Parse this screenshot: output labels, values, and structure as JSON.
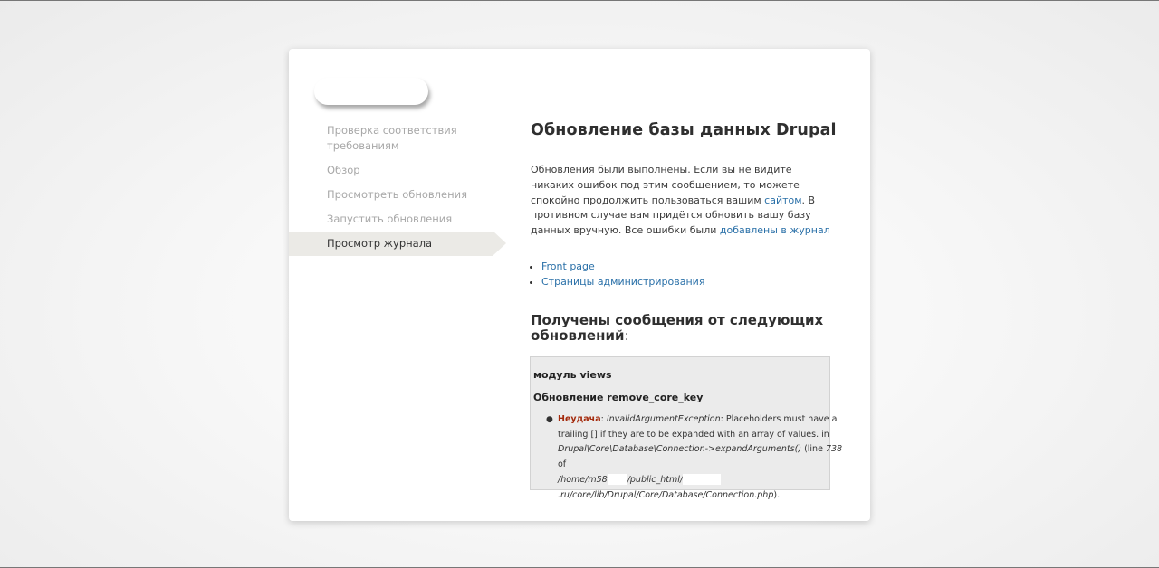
{
  "sidebar": {
    "items": [
      {
        "label": "Проверка соответствия требованиям"
      },
      {
        "label": "Обзор"
      },
      {
        "label": "Просмотреть обновления"
      },
      {
        "label": "Запустить обновления"
      },
      {
        "label": "Просмотр журнала"
      }
    ],
    "active_index": 4
  },
  "main": {
    "title": "Обновление базы данных Drupal",
    "intro_part1": "Обновления были выполнены. Если вы не видите никаких ошибок под этим сообщением, то можете спокойно продолжить пользоваться вашим ",
    "intro_link1": "сайтом",
    "intro_part2": ". В противном случае вам придётся обновить вашу базу данных вручную. Все ошибки были ",
    "intro_link2": "добавлены в журнал",
    "links": [
      {
        "label": "Front page"
      },
      {
        "label": "Страницы администрирования"
      }
    ],
    "messages_heading": "Получены сообщения от следующих обновлений",
    "messages_heading_colon": ":"
  },
  "messages": {
    "module": "модуль views",
    "update": "Обновление remove_core_key",
    "fail_label": "Неудача",
    "colon": ":",
    "exception": "InvalidArgumentException",
    "line1_rest": ": Placeholders must have a",
    "line2": "trailing [] if they are to be expanded with an array of values. in",
    "line3_code": "Drupal\\Core\\Database\\Connection->expandArguments()",
    "line3_rest": " (line ",
    "line_number": "738",
    "line4": "of",
    "path_part1": "/home/m58",
    "path_part2": "/public_html/",
    "path_part3": ".ru/core/lib/Drupal/Core/Database/Connection.php",
    "path_end": ")."
  },
  "colors": {
    "link": "#2a70a8",
    "fail": "#a42a0c",
    "active_nav_bg": "#ebeae6"
  }
}
